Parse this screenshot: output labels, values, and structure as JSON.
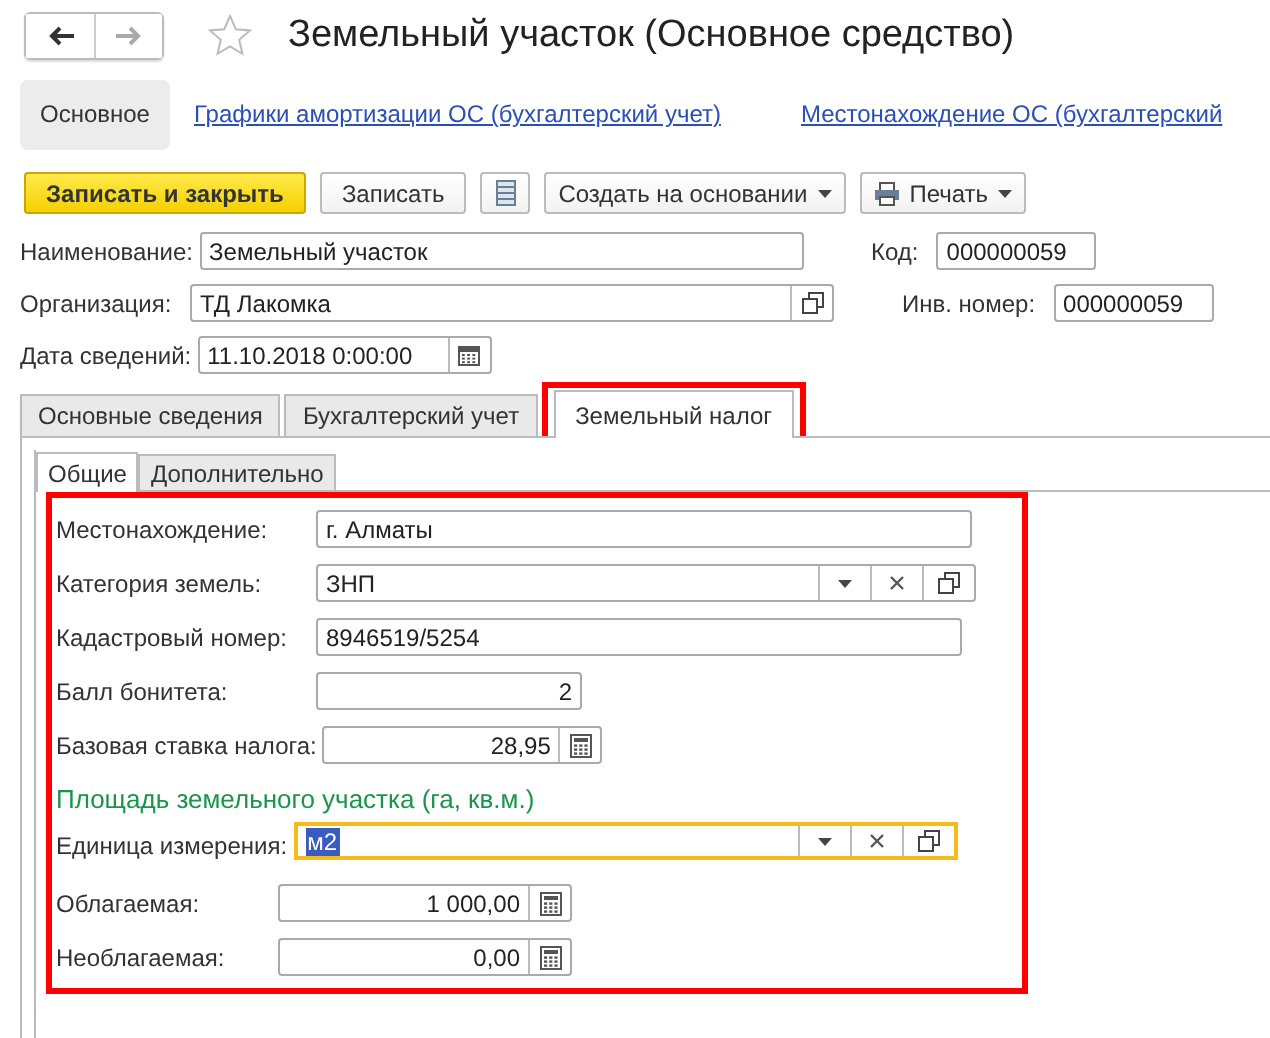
{
  "window": {
    "title": "Земельный участок (Основное средство)",
    "favorite": false
  },
  "nav_panel": [
    {
      "label": "Основное",
      "selected": true
    },
    {
      "label": "Графики амортизации ОС (бухгалтерский учет)",
      "selected": false
    },
    {
      "label": "Местонахождение ОС (бухгалтерский",
      "selected": false
    }
  ],
  "toolbar": [
    {
      "kind": "primary",
      "label": "Записать и закрыть"
    },
    {
      "kind": "plain",
      "label": "Записать"
    },
    {
      "kind": "list-icon"
    },
    {
      "kind": "menu",
      "label": "Создать на основании"
    },
    {
      "kind": "print-menu",
      "label": "Печать"
    }
  ],
  "header_fields": [
    {
      "label": "Наименование:",
      "value": "Земельный участок",
      "kind": "text",
      "side_label": "Код:",
      "side_value": "000000059"
    },
    {
      "label": "Организация:",
      "value": "ТД Лакомка",
      "kind": "ref",
      "side_label": "Инв. номер:",
      "side_value": "000000059"
    },
    {
      "label": "Дата сведений:",
      "value": "11.10.2018  0:00:00",
      "kind": "date"
    }
  ],
  "tabs": [
    {
      "label": "Основные сведения",
      "selected": false,
      "highlighted": false
    },
    {
      "label": "Бухгалтерский учет",
      "selected": false,
      "highlighted": false
    },
    {
      "label": "Земельный налог",
      "selected": true,
      "highlighted": true
    }
  ],
  "subtabs": [
    {
      "label": "Общие",
      "selected": true
    },
    {
      "label": "Дополнительно",
      "selected": false
    }
  ],
  "panel": {
    "highlighted": true,
    "fields": [
      {
        "label": "Местонахождение:",
        "value": "г. Алматы",
        "kind": "text",
        "focused": false
      },
      {
        "label": "Категория земель:",
        "value": "ЗНП",
        "kind": "select",
        "focused": false
      },
      {
        "label": "Кадастровый номер:",
        "value": "8946519/5254",
        "kind": "text",
        "focused": false
      },
      {
        "label": "Балл бонитета:",
        "value": "2",
        "kind": "number",
        "focused": false
      },
      {
        "label": "Базовая ставка налога:",
        "value": "28,95",
        "kind": "calc",
        "focused": false
      }
    ],
    "group": {
      "title": "Площадь земельного участка (га, кв.м.)",
      "fields": [
        {
          "label": "Единица измерения:",
          "value": "м2",
          "kind": "select",
          "focused": true
        },
        {
          "label": "Облагаемая:",
          "value": "1 000,00",
          "kind": "calc",
          "focused": false
        },
        {
          "label": "Необлагаемая:",
          "value": "0,00",
          "kind": "calc",
          "focused": false
        }
      ]
    }
  }
}
